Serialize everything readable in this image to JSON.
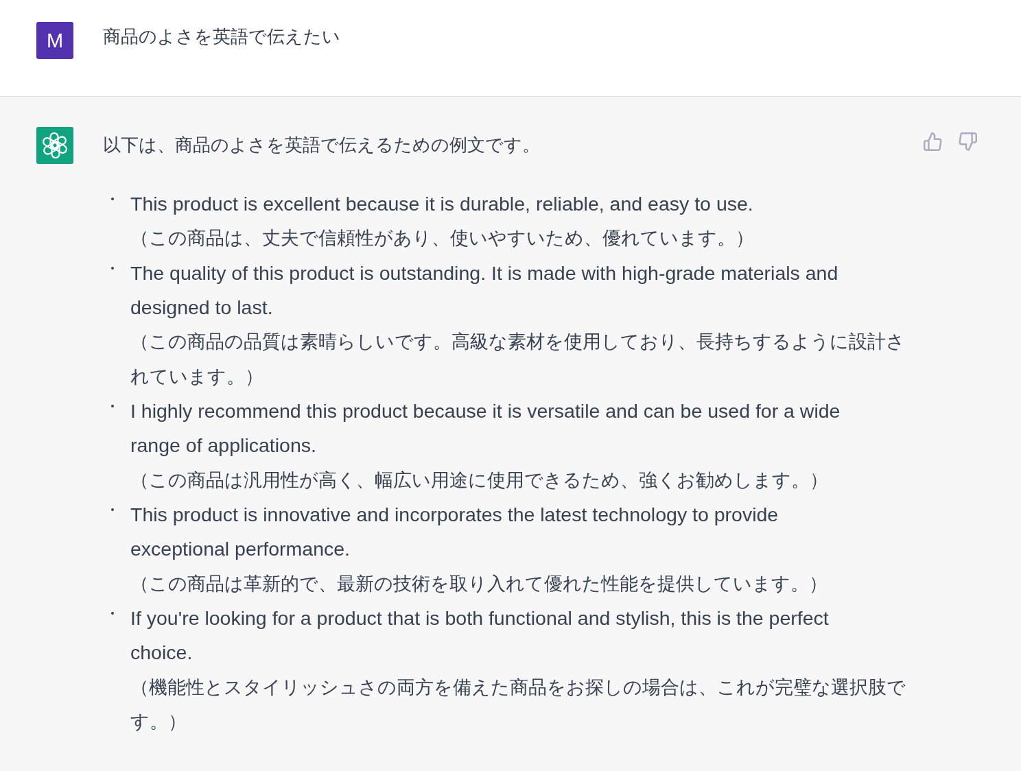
{
  "user_message": {
    "avatar_letter": "M",
    "text": "商品のよさを英語で伝えたい"
  },
  "assistant_message": {
    "intro": "以下は、商品のよさを英語で伝えるための例文です。",
    "items": [
      {
        "english": "This product is excellent because it is durable, reliable, and easy to use.",
        "japanese": "（この商品は、丈夫で信頼性があり、使いやすいため、優れています。）"
      },
      {
        "english": "The quality of this product is outstanding. It is made with high-grade materials and designed to last.",
        "japanese": "（この商品の品質は素晴らしいです。高級な素材を使用しており、長持ちするように設計されています。）"
      },
      {
        "english": "I highly recommend this product because it is versatile and can be used for a wide range of applications.",
        "japanese": "（この商品は汎用性が高く、幅広い用途に使用できるため、強くお勧めします。）"
      },
      {
        "english": "This product is innovative and incorporates the latest technology to provide exceptional performance.",
        "japanese": "（この商品は革新的で、最新の技術を取り入れて優れた性能を提供しています。）"
      },
      {
        "english": "If you're looking for a product that is both functional and stylish, this is the perfect choice.",
        "japanese": "（機能性とスタイリッシュさの両方を備えた商品をお探しの場合は、これが完璧な選択肢です。）"
      }
    ]
  }
}
